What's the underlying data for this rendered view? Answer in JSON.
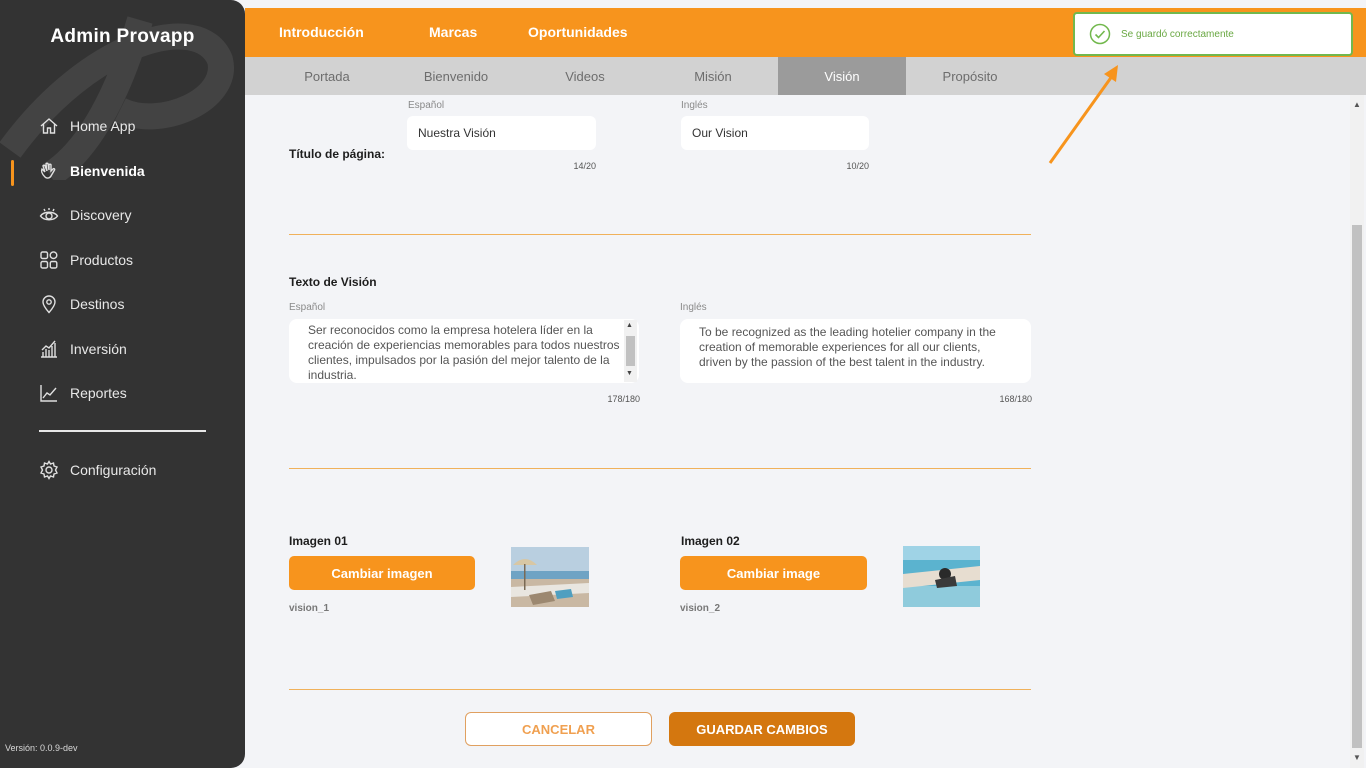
{
  "app": {
    "title": "Admin Provapp",
    "version": "Versión: 0.0.9-dev"
  },
  "sidebar": {
    "items": [
      {
        "label": "Home App",
        "icon": "home-icon"
      },
      {
        "label": "Bienvenida",
        "icon": "waving-hand-icon",
        "active": true
      },
      {
        "label": "Discovery",
        "icon": "eye-icon"
      },
      {
        "label": "Productos",
        "icon": "grid-icon"
      },
      {
        "label": "Destinos",
        "icon": "location-pin-icon"
      },
      {
        "label": "Inversión",
        "icon": "bar-chart-icon"
      },
      {
        "label": "Reportes",
        "icon": "line-chart-icon"
      }
    ],
    "settings": {
      "label": "Configuración",
      "icon": "gear-icon"
    }
  },
  "topnav": {
    "tabs": [
      "Introducción",
      "Marcas",
      "Oportunidades"
    ]
  },
  "subnav": {
    "tabs": [
      "Portada",
      "Bienvenido",
      "Videos",
      "Misión",
      "Visión",
      "Propósito"
    ],
    "active": "Visión"
  },
  "toast": {
    "message": "Se guardó correctamente",
    "color": "#72b84d"
  },
  "page_title": {
    "label": "Título de página:",
    "es": {
      "lang": "Español",
      "value": "Nuestra Visión",
      "counter": "14/20"
    },
    "en": {
      "lang": "Inglés",
      "value": "Our Vision",
      "counter": "10/20"
    }
  },
  "vision_text": {
    "label": "Texto de Visión",
    "es": {
      "lang": "Español",
      "value": "Ser reconocidos como la empresa hotelera líder en la creación de experiencias memorables para todos nuestros clientes, impulsados por la pasión del mejor talento de la industria.",
      "counter": "178/180"
    },
    "en": {
      "lang": "Inglés",
      "value": "To be recognized as the leading hotelier company in the creation of memorable experiences for all our clients, driven by the passion of the best talent in the industry.",
      "counter": "168/180"
    }
  },
  "images": [
    {
      "label": "Imagen 01",
      "button": "Cambiar imagen",
      "filename": "vision_1"
    },
    {
      "label": "Imagen 02",
      "button": "Cambiar image",
      "filename": "vision_2"
    }
  ],
  "actions": {
    "cancel": "CANCELAR",
    "save": "GUARDAR CAMBIOS"
  },
  "colors": {
    "accent": "#f7941d",
    "sidebar": "#333333",
    "save": "#d4770f"
  }
}
